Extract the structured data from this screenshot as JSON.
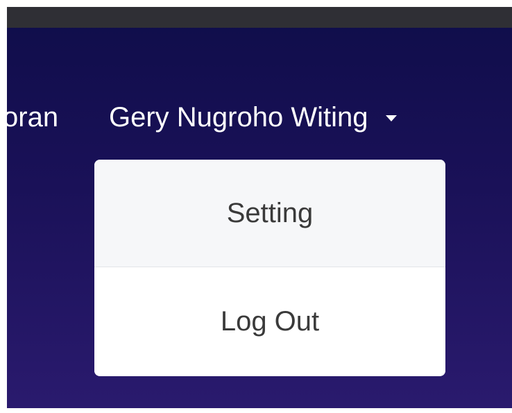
{
  "navbar": {
    "partial_link_label": "oran",
    "user_name": "Gery Nugroho Witing"
  },
  "dropdown": {
    "items": [
      {
        "label": "Setting"
      },
      {
        "label": "Log Out"
      }
    ]
  },
  "icons": {
    "user_menu_caret": "caret-down-icon"
  },
  "colors": {
    "navbar_background": "#1a1158",
    "dropdown_background": "#ffffff",
    "hover_item_background": "#f6f7f9"
  }
}
